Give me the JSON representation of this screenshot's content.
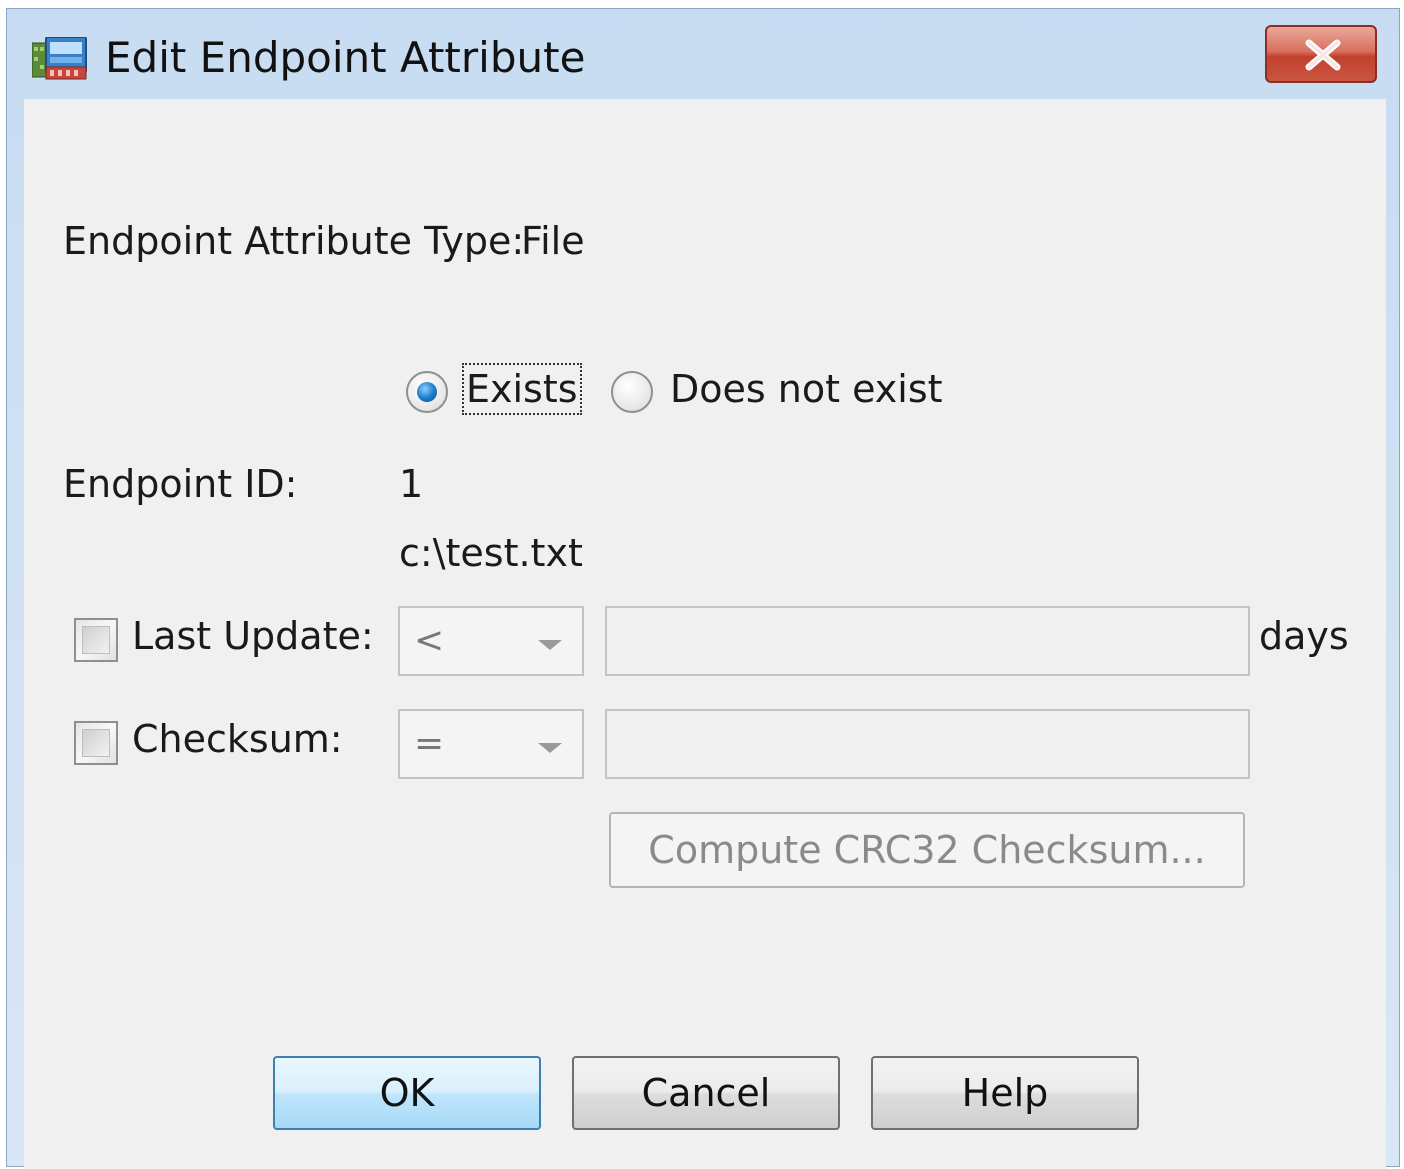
{
  "window": {
    "title": "Edit Endpoint Attribute",
    "icon": "endpoint-attribute-app-icon",
    "close_icon": "close-x-icon"
  },
  "form": {
    "attribute_type_label": "Endpoint Attribute Type:",
    "attribute_type_value": "File",
    "existence_options": [
      {
        "label": "Exists",
        "selected": true
      },
      {
        "label": "Does not exist",
        "selected": false
      }
    ],
    "endpoint_id_label": "Endpoint ID:",
    "endpoint_id_value": "1",
    "file_path": "c:\\test.txt",
    "last_update": {
      "label": "Last Update:",
      "checked": false,
      "operator": "<",
      "value": "",
      "unit": "days"
    },
    "checksum": {
      "label": "Checksum:",
      "checked": false,
      "operator": "=",
      "value": ""
    },
    "compute_button_label": "Compute CRC32 Checksum..."
  },
  "buttons": {
    "ok": "OK",
    "cancel": "Cancel",
    "help": "Help"
  }
}
